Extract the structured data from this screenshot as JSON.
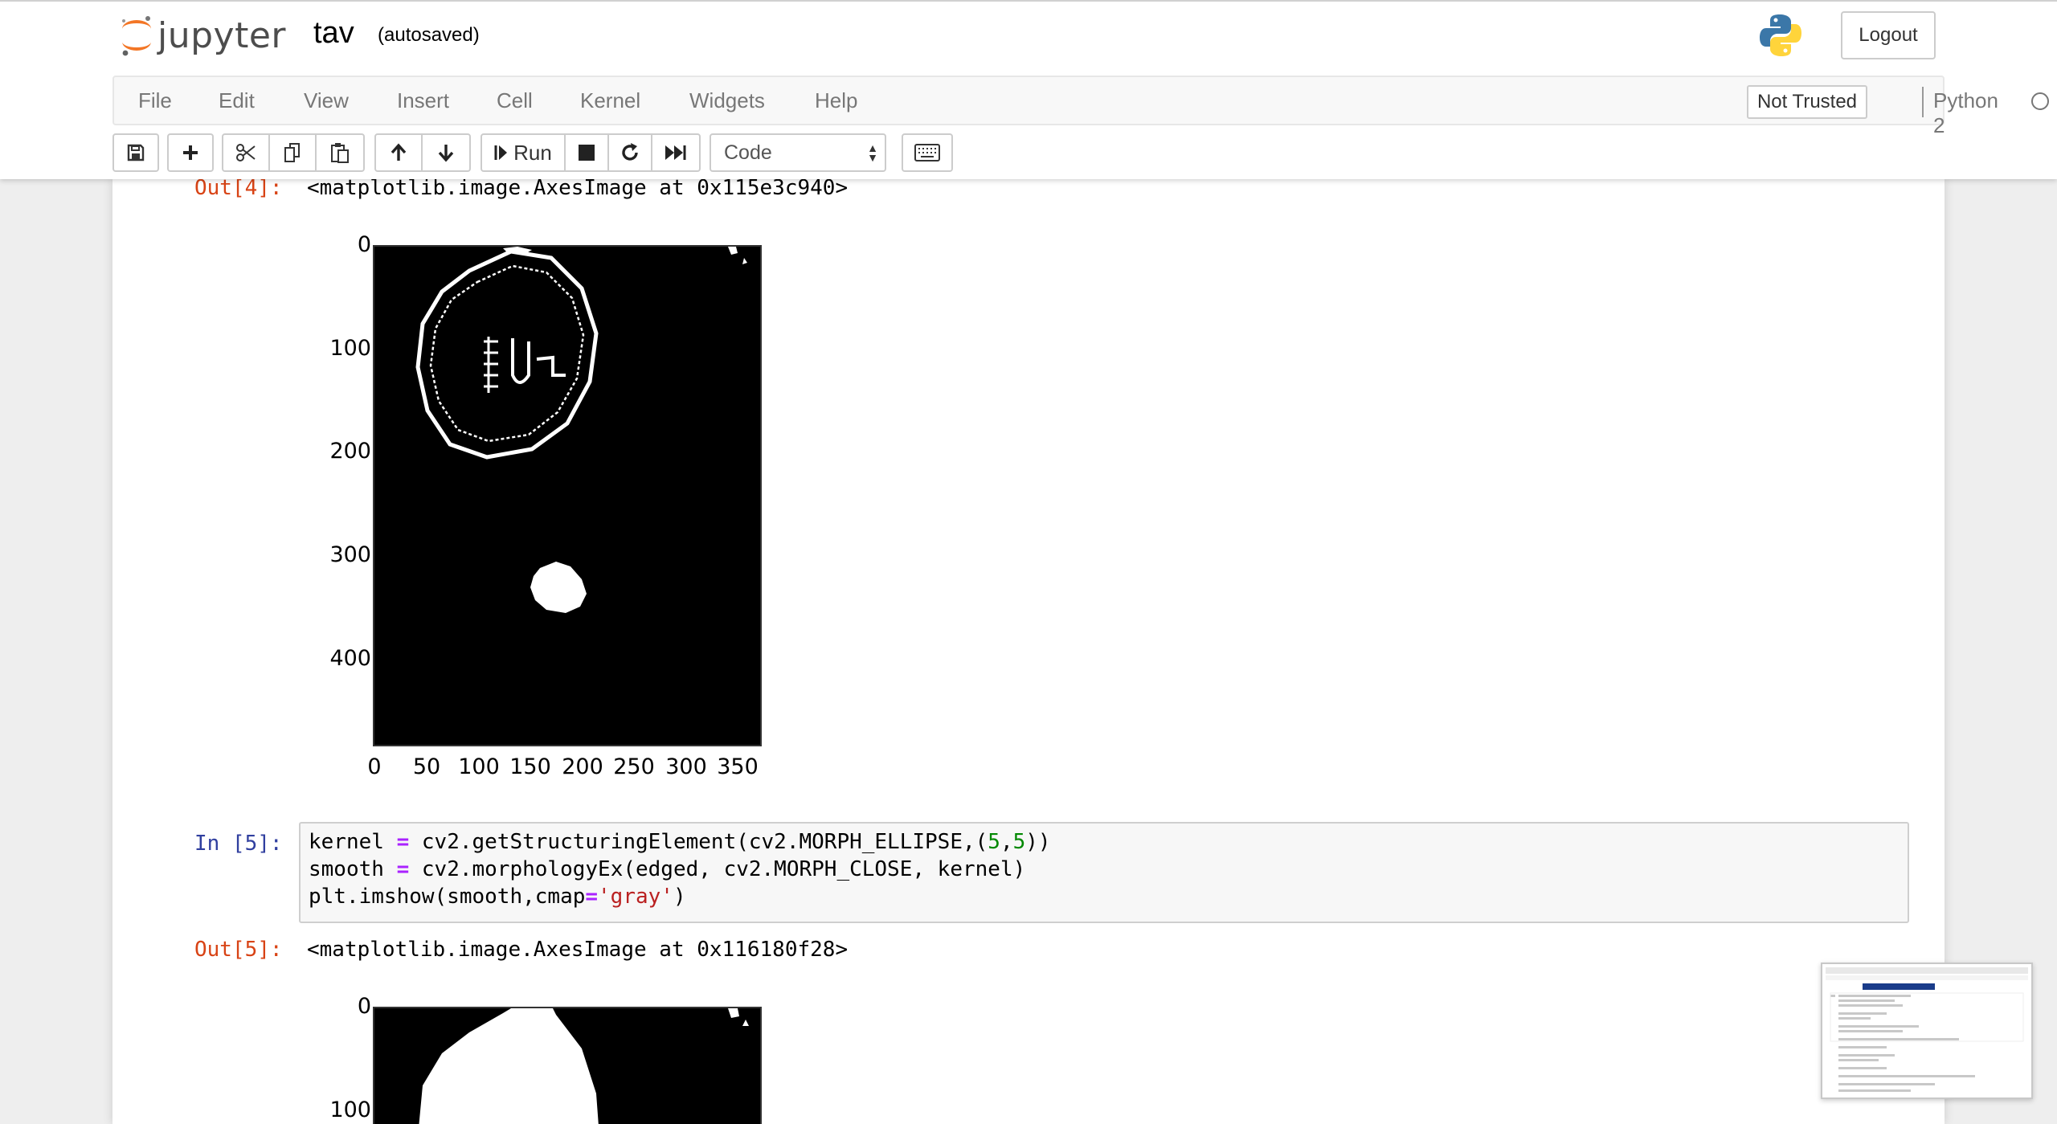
{
  "header": {
    "logo_text": "jupyter",
    "notebook_name": "tav",
    "autosave_status": "(autosaved)",
    "logout_label": "Logout"
  },
  "menubar": {
    "items": [
      "File",
      "Edit",
      "View",
      "Insert",
      "Cell",
      "Kernel",
      "Widgets",
      "Help"
    ],
    "trust_label": "Not Trusted",
    "kernel_name": "Python 2"
  },
  "toolbar": {
    "run_label": "Run",
    "cell_type": "Code",
    "icons": [
      "save-icon",
      "plus-icon",
      "scissors-icon",
      "copy-icon",
      "paste-icon",
      "arrow-up-icon",
      "arrow-down-icon",
      "step-forward-icon",
      "stop-icon",
      "restart-icon",
      "fast-forward-icon",
      "keyboard-icon"
    ]
  },
  "cells": {
    "out4": {
      "prompt": "Out[4]:",
      "text": "<matplotlib.image.AxesImage at 0x115e3c940>",
      "y_ticks": [
        "0",
        "100",
        "200",
        "300",
        "400"
      ],
      "x_ticks": [
        "0",
        "50",
        "100",
        "150",
        "200",
        "250",
        "300",
        "350"
      ]
    },
    "in5": {
      "prompt": "In [5]:",
      "line1": {
        "a": "kernel ",
        "op1": "=",
        "b": " cv2.getStructuringElement(cv2.MORPH_ELLIPSE,(",
        "n1": "5",
        "c": ",",
        "n2": "5",
        "d": "))"
      },
      "line2": {
        "a": "smooth ",
        "op1": "=",
        "b": " cv2.morphologyEx(edged, cv2.MORPH_CLOSE, kernel)"
      },
      "line3": {
        "a": "plt.imshow(smooth,cmap",
        "op1": "=",
        "s": "'gray'",
        "b": ")"
      }
    },
    "out5": {
      "prompt": "Out[5]:",
      "text": "<matplotlib.image.AxesImage at 0x116180f28>",
      "y_ticks": [
        "0",
        "100"
      ]
    }
  },
  "colors": {
    "out_prompt": "#d84315",
    "in_prompt": "#303f9f",
    "logo_orange": "#f37626"
  }
}
